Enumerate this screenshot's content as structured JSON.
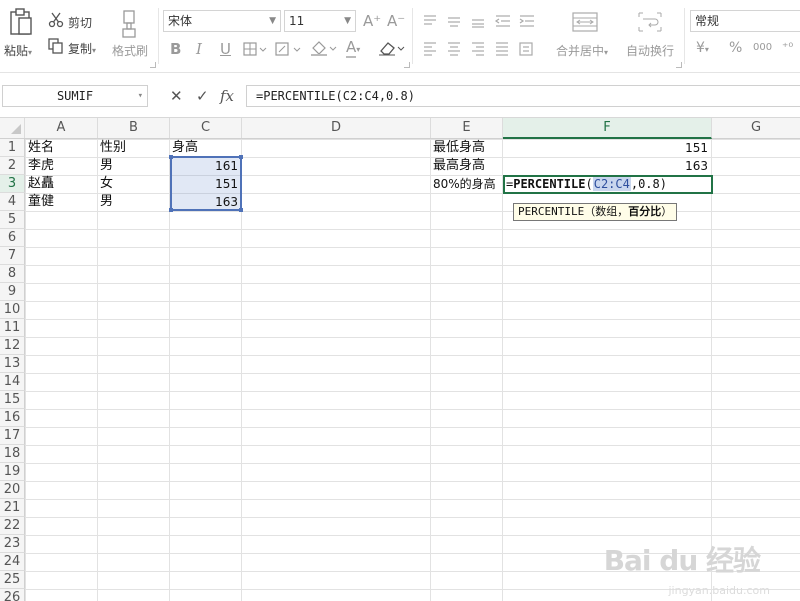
{
  "ribbon": {
    "paste_label": "粘贴",
    "cut_label": "剪切",
    "copy_label": "复制",
    "format_painter_label": "格式刷",
    "font_name": "宋体",
    "font_size": "11",
    "grow_font": "A⁺",
    "shrink_font": "A⁻",
    "bold": "B",
    "italic": "I",
    "underline": "U",
    "font_color_glyph": "A",
    "merge_center_label": "合并居中",
    "wrap_text_label": "自动换行",
    "number_format": "常规",
    "currency_glyph": "¥",
    "percent_glyph": "%",
    "thousands_glyph": "000"
  },
  "formula_bar": {
    "name_box": "SUMIF",
    "cancel_glyph": "✕",
    "enter_glyph": "✓",
    "fx_glyph": "fx",
    "formula": "=PERCENTILE(C2:C4,0.8)"
  },
  "columns": [
    {
      "id": "A",
      "label": "A"
    },
    {
      "id": "B",
      "label": "B"
    },
    {
      "id": "C",
      "label": "C"
    },
    {
      "id": "D",
      "label": "D"
    },
    {
      "id": "E",
      "label": "E"
    },
    {
      "id": "F",
      "label": "F"
    },
    {
      "id": "G",
      "label": "G"
    }
  ],
  "rows": [
    "1",
    "2",
    "3",
    "4",
    "5",
    "6",
    "7",
    "8",
    "9",
    "10",
    "11",
    "12",
    "13",
    "14",
    "15",
    "16",
    "17",
    "18",
    "19",
    "20",
    "21",
    "22",
    "23",
    "24",
    "25",
    "26"
  ],
  "sheet": {
    "A1": "姓名",
    "B1": "性别",
    "C1": "身高",
    "A2": "李虎",
    "B2": "男",
    "C2": "161",
    "A3": "赵矗",
    "B3": "女",
    "C3": "151",
    "A4": "童健",
    "B4": "男",
    "C4": "163",
    "E1": "最低身高",
    "F1": "151",
    "E2": "最高身高",
    "F2": "163",
    "E3": "80%的身高"
  },
  "editing": {
    "prefix": "=",
    "function": "PERCENTILE",
    "open_paren": "(",
    "range_ref": "C2:C4",
    "rest": ",0.8)"
  },
  "tooltip": {
    "function": "PERCENTILE",
    "args_open": "（数组，",
    "current_arg": "百分比",
    "args_close": "）"
  },
  "watermark": {
    "main": "Bai du 经验",
    "sub": "jingyan.baidu.com"
  },
  "colors": {
    "accent": "#217346",
    "selection": "#4f72b8"
  }
}
